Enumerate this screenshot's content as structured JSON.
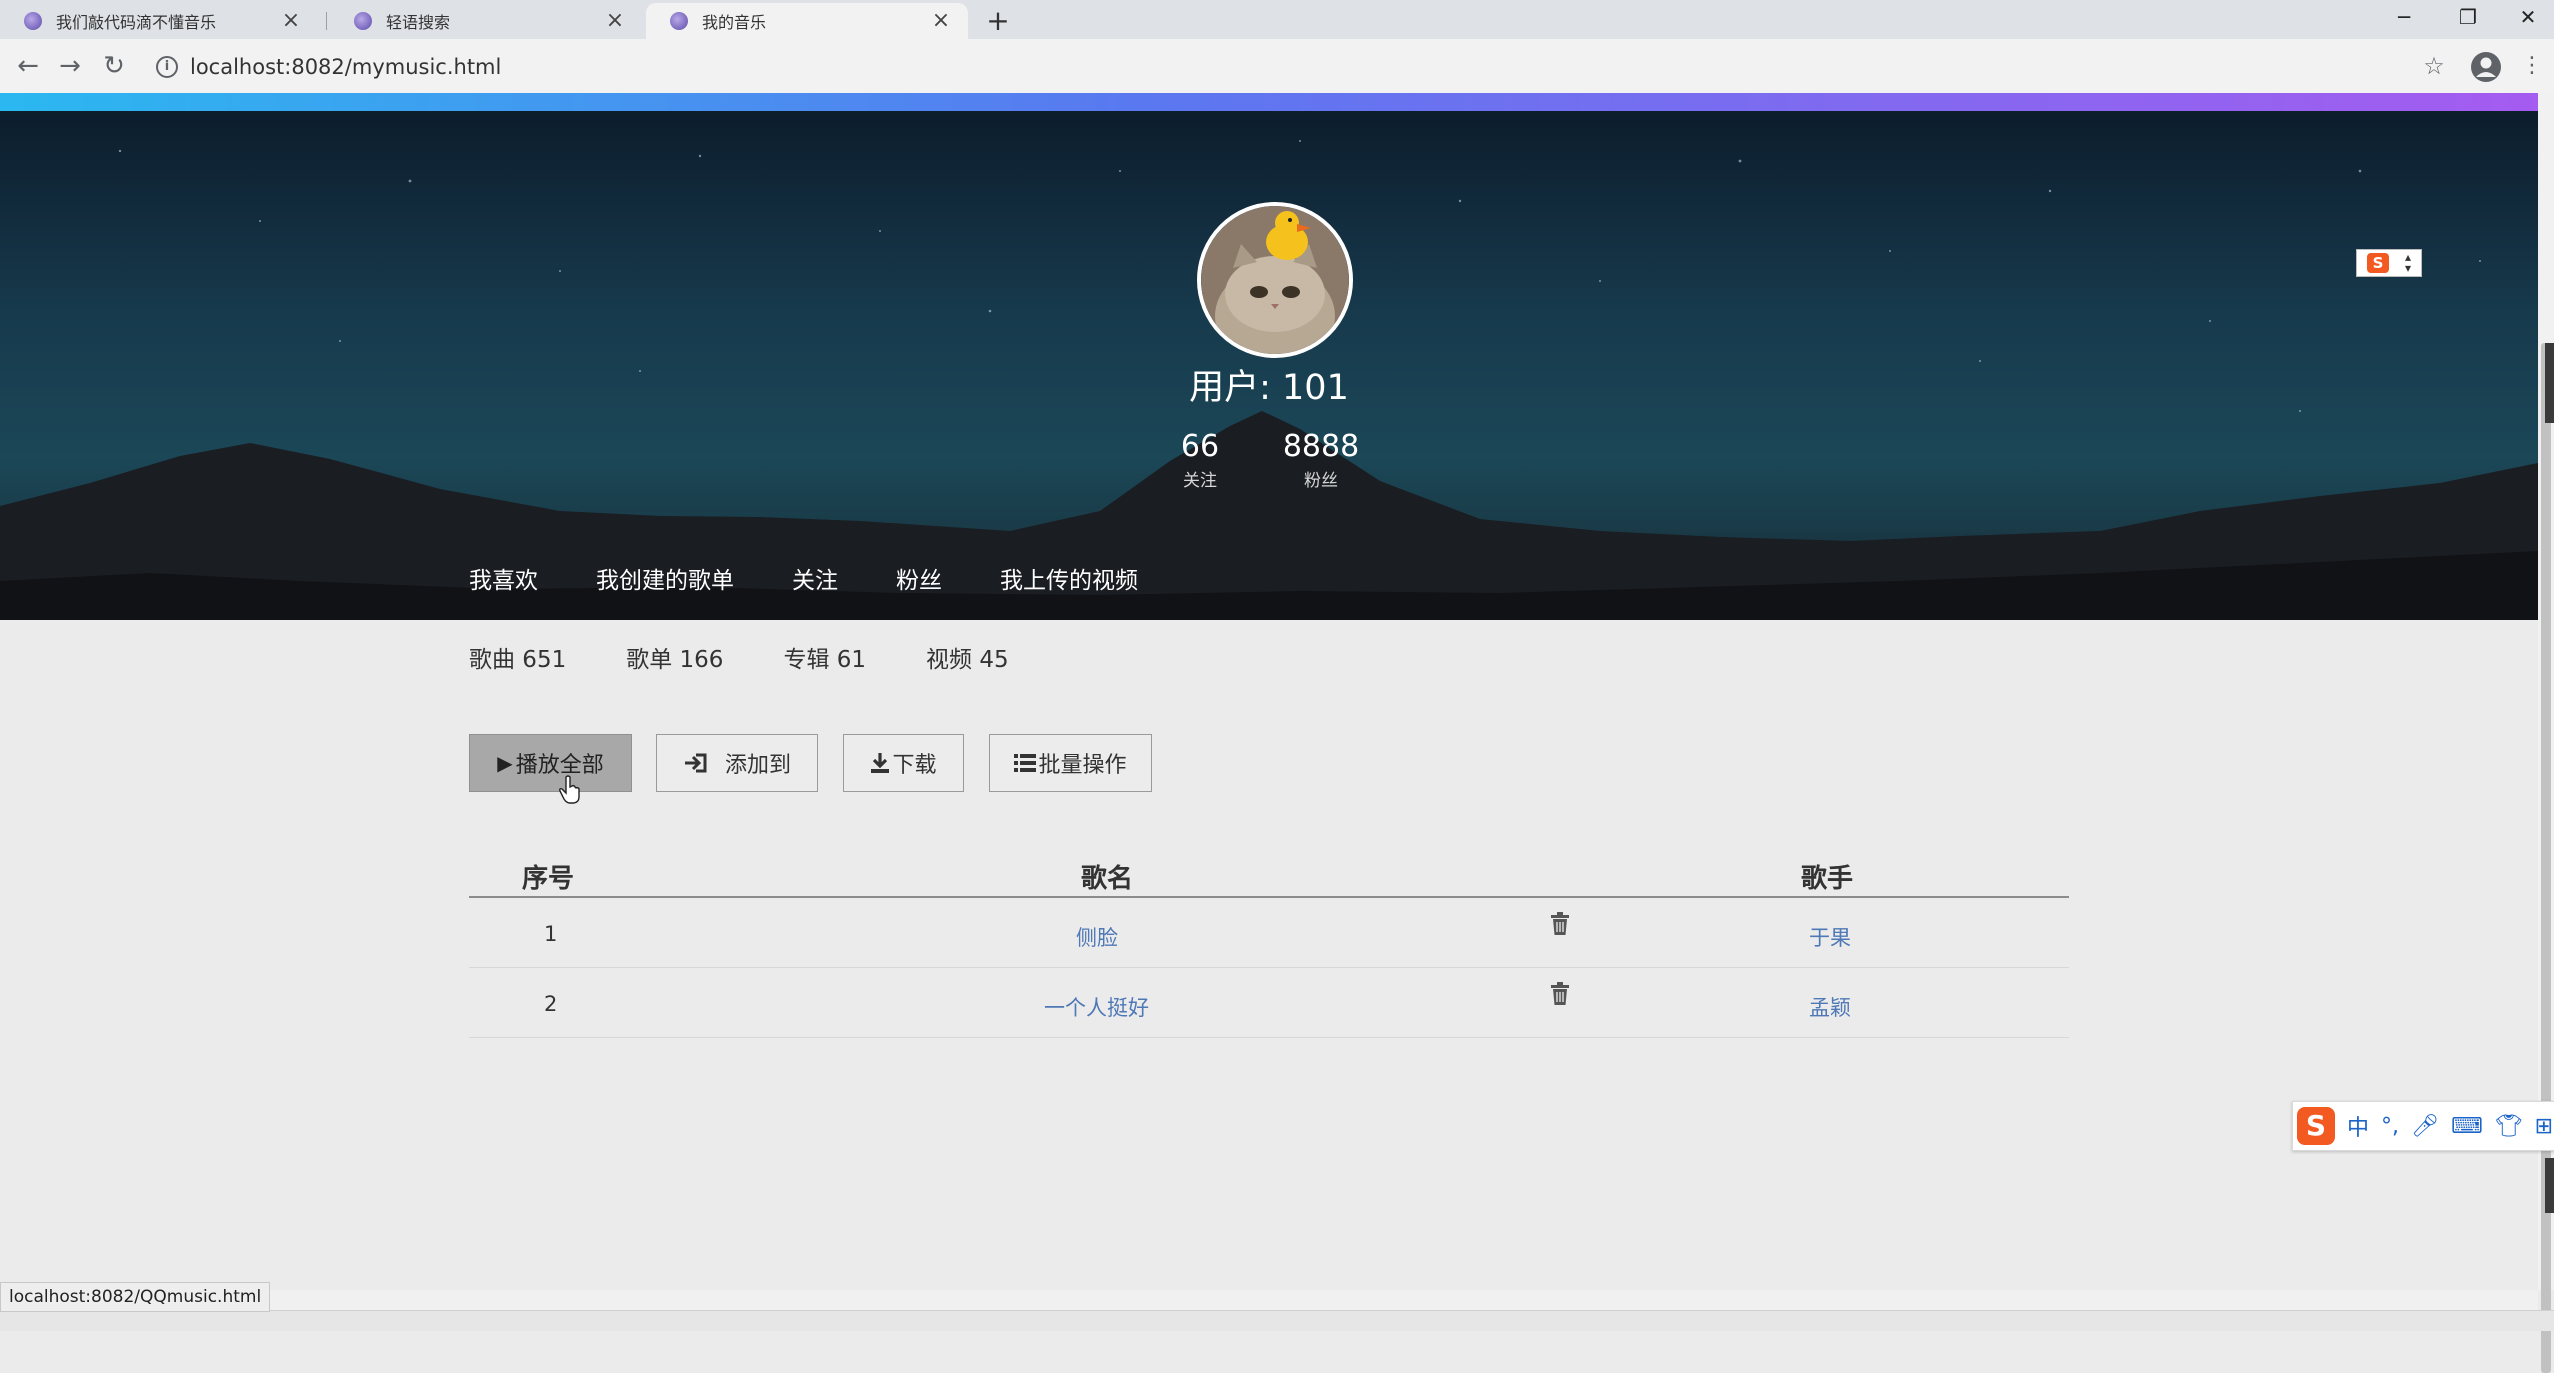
{
  "browser": {
    "tabs": [
      {
        "title": "我们敲代码滴不懂音乐",
        "close": "×"
      },
      {
        "title": "轻语搜索",
        "close": "×"
      },
      {
        "title": "我的音乐",
        "close": "×"
      }
    ],
    "new_tab": "+",
    "url": "localhost:8082/mymusic.html",
    "status_url": "localhost:8082/QQmusic.html"
  },
  "profile": {
    "username": "用户: 101",
    "following_count": "66",
    "following_label": "关注",
    "followers_count": "8888",
    "followers_label": "粉丝"
  },
  "nav_tabs": [
    "我喜欢",
    "我创建的歌单",
    "关注",
    "粉丝",
    "我上传的视频"
  ],
  "counts": [
    "歌曲 651",
    "歌单 166",
    "专辑 61",
    "视频 45"
  ],
  "buttons": {
    "play_all": "播放全部",
    "add_to": "添加到",
    "download": "下载",
    "batch": "批量操作"
  },
  "table": {
    "headers": {
      "index": "序号",
      "song": "歌名",
      "artist": "歌手"
    },
    "rows": [
      {
        "index": "1",
        "song": "侧脸",
        "artist": "于果"
      },
      {
        "index": "2",
        "song": "一个人挺好",
        "artist": "孟颖"
      }
    ]
  },
  "ime": {
    "mode": "中",
    "punct": "°,"
  },
  "colors": {
    "link": "#4f78b6",
    "gradient_start": "#2bb8f0",
    "gradient_end": "#a55cf0",
    "ime_brand": "#f25a22"
  }
}
